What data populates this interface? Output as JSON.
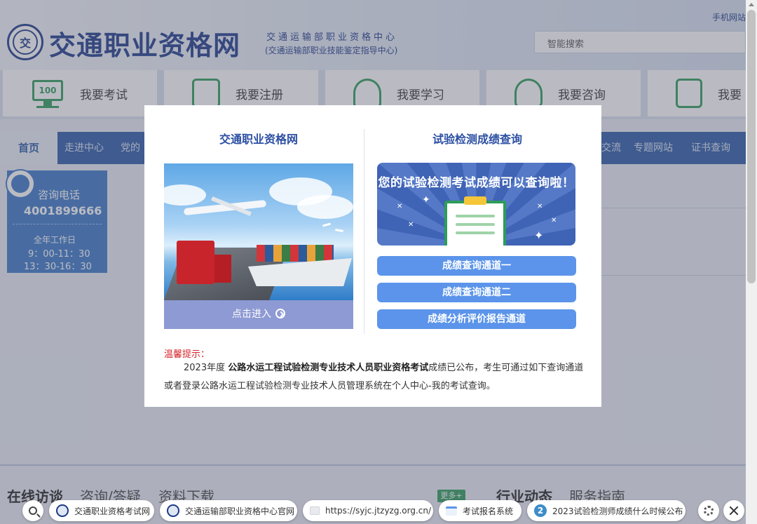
{
  "header": {
    "site_title": "交通职业资格网",
    "subtitle_line1": "交通运输部职业资格中心",
    "subtitle_line2": "(交通运输部职业技能鉴定指导中心)",
    "mobile_link": "手机网站",
    "search_placeholder": "智能搜索"
  },
  "quick_links": [
    {
      "label": "我要考试",
      "icon": "monitor-100-icon"
    },
    {
      "label": "我要注册",
      "icon": "registration-card-icon"
    },
    {
      "label": "我要学习",
      "icon": "student-icon"
    },
    {
      "label": "我要咨询",
      "icon": "headset-icon"
    },
    {
      "label": "我要",
      "icon": "document-search-icon"
    }
  ],
  "nav": {
    "home": "首页",
    "items": [
      "走进中心",
      "党的",
      "交流",
      "专题网站",
      "证书查询"
    ]
  },
  "hotline": {
    "title": "咨询电话",
    "phone": "4001899666",
    "hours_title": "全年工作日",
    "hours_am": "9：00-11：30",
    "hours_pm": "13：30-16：30"
  },
  "bottom_section": {
    "tabs": [
      "在线访谈",
      "咨询/答疑",
      "资料下载"
    ],
    "more": "更多+",
    "right_tabs": [
      "行业动态",
      "服务指南"
    ]
  },
  "modal": {
    "left_title": "交通职业资格网",
    "left_enter": "点击进入",
    "right_title": "试验检测成绩查询",
    "banner_text": "您的试验检测考试成绩可以查询啦！",
    "buttons": [
      "成绩查询通道一",
      "成绩查询通道二",
      "成绩分析评价报告通道"
    ],
    "notice_title": "温馨提示：",
    "notice_year": "2023年度",
    "notice_bold": "公路水运工程试验检测专业技术人员职业资格考试",
    "notice_rest": "成绩已公布，考生可通过如下查询通道或者登录公路水运工程试验检测专业技术人员管理系统在个人中心-我的考试查询。"
  },
  "tabbar": {
    "tabs": [
      {
        "label": "交通职业资格考试网",
        "icon": "emblem-favicon"
      },
      {
        "label": "交通运输部职业资格中心官网",
        "icon": "emblem-favicon"
      },
      {
        "label": "https://syjc.jtzyzg.org.cn/",
        "icon": "page-favicon"
      },
      {
        "label": "考试报名系统",
        "icon": "doc-favicon"
      },
      {
        "label": "2023试验检测师成绩什么时候公布",
        "icon": "number-favicon",
        "badge": "2"
      }
    ]
  },
  "colors": {
    "brand_blue": "#1d3a8a",
    "nav_blue": "#2b5aa8",
    "button_blue": "#5b94ea",
    "accent_green": "#2e9c5a",
    "notice_red": "#d6262c"
  }
}
